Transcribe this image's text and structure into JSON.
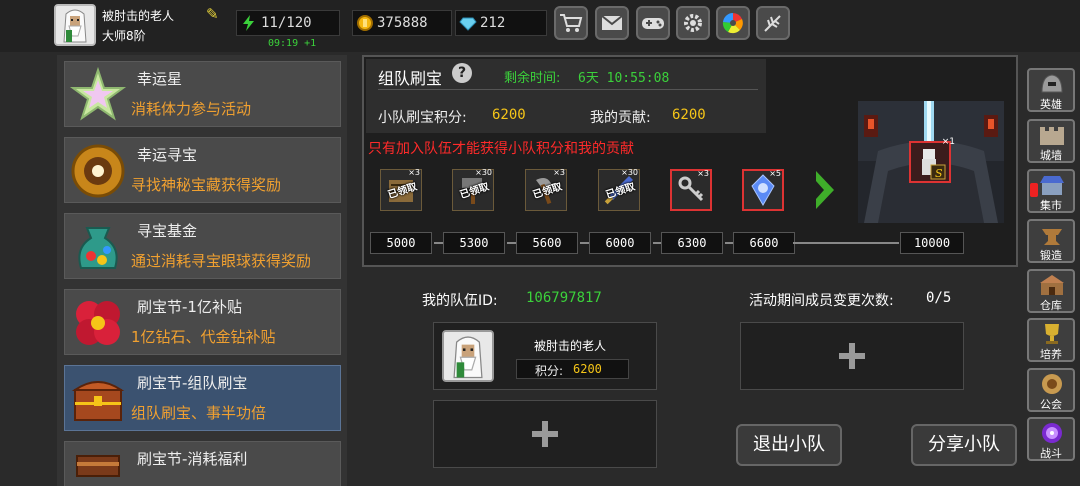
{
  "player": {
    "name": "被肘击的老人",
    "rank": "大师8阶"
  },
  "resources": {
    "energy": "11/120",
    "energy_timer": "09:19 +1",
    "gold": "375888",
    "gems": "212"
  },
  "top_buttons": [
    "shop-cart-icon",
    "mail-icon",
    "gamepad-icon",
    "settings-gear-icon",
    "color-wheel-icon",
    "feather-icon"
  ],
  "events": [
    {
      "title": "幸运星",
      "desc": "消耗体力参与活动",
      "icon": "star-icon"
    },
    {
      "title": "幸运寻宝",
      "desc": "寻找神秘宝藏获得奖励",
      "icon": "golden-disc-icon"
    },
    {
      "title": "寻宝基金",
      "desc": "通过消耗寻宝眼球获得奖励",
      "icon": "treasure-bag-icon"
    },
    {
      "title": "刷宝节-1亿补贴",
      "desc": "1亿钻石、代金钻补贴",
      "icon": "red-flower-icon"
    },
    {
      "title": "刷宝节-组队刷宝",
      "desc": "组队刷宝、事半功倍",
      "icon": "treasure-chest-icon"
    },
    {
      "title": "刷宝节-消耗福利",
      "desc": "",
      "icon": "gift-chest-icon"
    }
  ],
  "team_hunt": {
    "title": "组队刷宝",
    "time_label": "剩余时间:",
    "time_value": "6天 10:55:08",
    "team_score_label": "小队刷宝积分:",
    "team_score": "6200",
    "contrib_label": "我的贡献:",
    "contrib_value": "6200",
    "warning": "只有加入队伍才能获得小队积分和我的贡献",
    "rewards": [
      {
        "qty": "×3",
        "claimed": "已领取",
        "icon": "scroll-icon"
      },
      {
        "qty": "×30",
        "claimed": "已领取",
        "icon": "hammer-icon"
      },
      {
        "qty": "×3",
        "claimed": "已领取",
        "icon": "axe-icon"
      },
      {
        "qty": "×30",
        "claimed": "已领取",
        "icon": "blue-sword-icon"
      },
      {
        "qty": "×3",
        "claimed": "",
        "icon": "keys-icon"
      },
      {
        "qty": "×5",
        "claimed": "",
        "icon": "blue-crystal-icon"
      }
    ],
    "milestones": [
      "5000",
      "5300",
      "5600",
      "6000",
      "6300",
      "6600"
    ],
    "final_milestone": "10000",
    "final_reward_qty": "×1"
  },
  "team": {
    "id_label": "我的队伍ID:",
    "id_value": "106797817",
    "changes_label": "活动期间成员变更次数:",
    "changes_value": "0/5",
    "member": {
      "name": "被肘击的老人",
      "score_label": "积分:",
      "score": "6200"
    },
    "leave_label": "退出小队",
    "share_label": "分享小队"
  },
  "sidebar": [
    {
      "label": "英雄",
      "icon": "helmet-icon"
    },
    {
      "label": "城墙",
      "icon": "wall-icon"
    },
    {
      "label": "集市",
      "icon": "market-icon"
    },
    {
      "label": "锻造",
      "icon": "anvil-icon"
    },
    {
      "label": "仓库",
      "icon": "warehouse-icon"
    },
    {
      "label": "培养",
      "icon": "trophy-icon"
    },
    {
      "label": "公会",
      "icon": "guild-icon"
    },
    {
      "label": "战斗",
      "icon": "portal-icon"
    }
  ]
}
